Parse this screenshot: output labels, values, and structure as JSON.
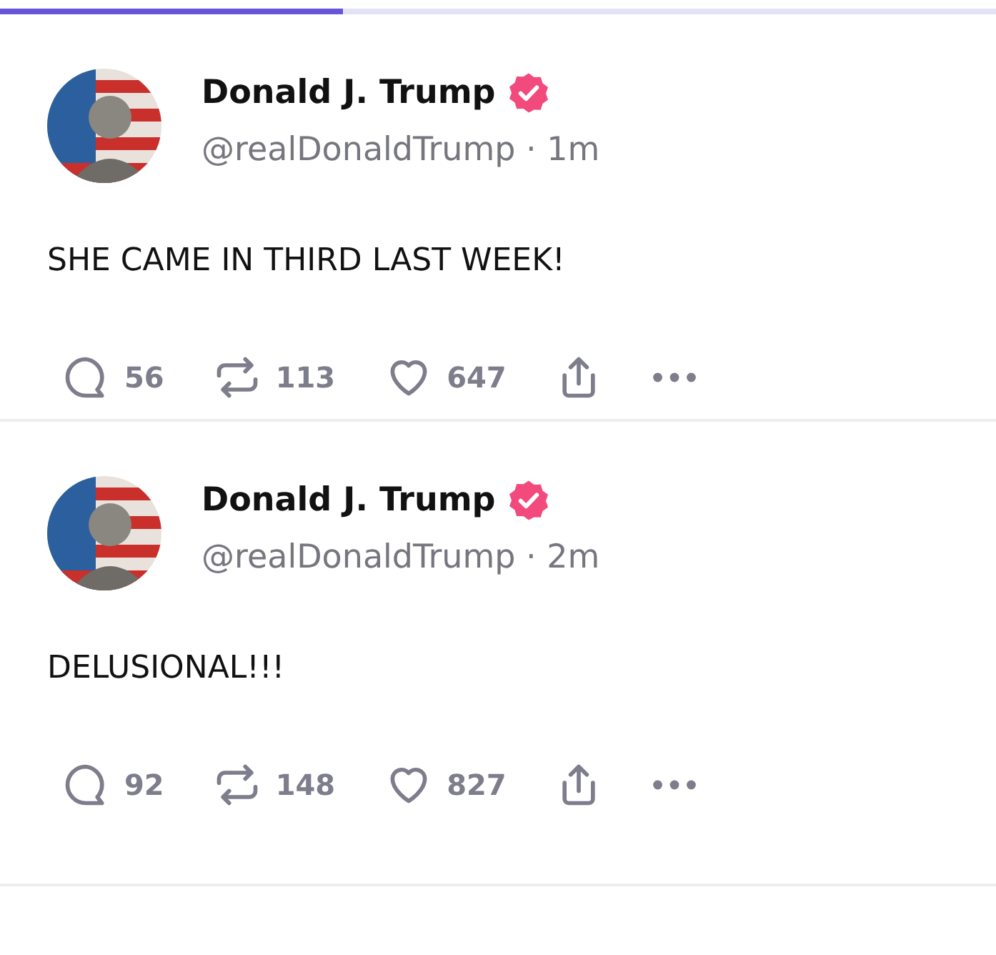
{
  "progress": {
    "level": 0.345
  },
  "posts": [
    {
      "author": "Donald J. Trump",
      "verified": true,
      "meta": "@realDonaldTrump · 1m",
      "text": "SHE CAME IN THIRD LAST WEEK!",
      "replies": "56",
      "reposts": "113",
      "likes": "647"
    },
    {
      "author": "Donald J. Trump",
      "verified": true,
      "meta": "@realDonaldTrump · 2m",
      "text": "DELUSIONAL!!!",
      "replies": "92",
      "reposts": "148",
      "likes": "827"
    }
  ]
}
